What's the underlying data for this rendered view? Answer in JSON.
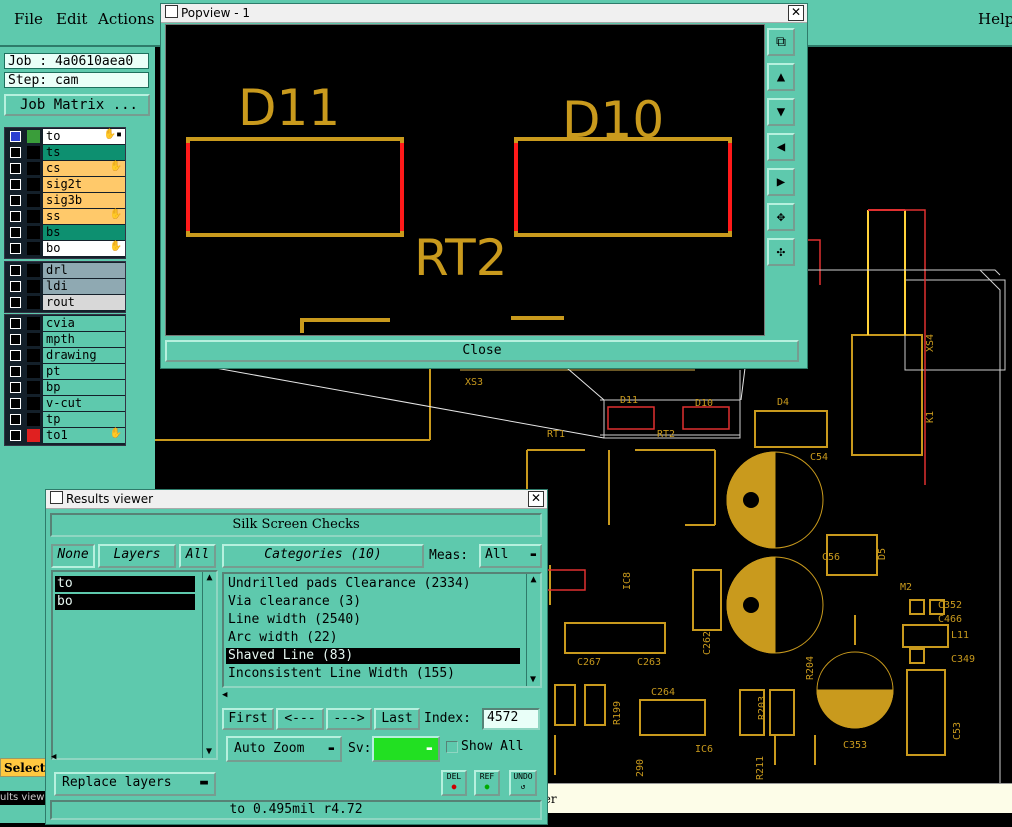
{
  "menubar": {
    "file": "File",
    "edit": "Edit",
    "actions": "Actions",
    "help": "Help"
  },
  "left": {
    "job": "Job : 4a0610aea0",
    "step": "Step: cam",
    "job_matrix": "Job Matrix ...",
    "layers_group1": [
      {
        "name": "to",
        "swatch": "#3a9d3a",
        "bg": "#ffffff",
        "mark": "✋▪",
        "selected": true
      },
      {
        "name": "ts",
        "swatch": "#000000",
        "bg": "#0d9070",
        "mark": ""
      },
      {
        "name": "cs",
        "swatch": "#000000",
        "bg": "#ffc96a",
        "mark": "✋"
      },
      {
        "name": "sig2t",
        "swatch": "#000000",
        "bg": "#ffc96a",
        "mark": ""
      },
      {
        "name": "sig3b",
        "swatch": "#000000",
        "bg": "#ffc96a",
        "mark": ""
      },
      {
        "name": "ss",
        "swatch": "#000000",
        "bg": "#ffc96a",
        "mark": "✋"
      },
      {
        "name": "bs",
        "swatch": "#000000",
        "bg": "#0d9070",
        "mark": ""
      },
      {
        "name": "bo",
        "swatch": "#000000",
        "bg": "#ffffff",
        "mark": "✋"
      }
    ],
    "layers_group2": [
      {
        "name": "drl",
        "swatch": "#000000",
        "bg": "#8fa9b2",
        "mark": ""
      },
      {
        "name": "ldi",
        "swatch": "#000000",
        "bg": "#8fa9b2",
        "mark": ""
      },
      {
        "name": "rout",
        "swatch": "#000000",
        "bg": "#d8d8d8",
        "mark": ""
      }
    ],
    "layers_group3": [
      {
        "name": "cvia",
        "swatch": "#000000",
        "bg": "#5ec9ad",
        "mark": ""
      },
      {
        "name": "mpth",
        "swatch": "#000000",
        "bg": "#5ec9ad",
        "mark": ""
      },
      {
        "name": "drawing",
        "swatch": "#000000",
        "bg": "#5ec9ad",
        "mark": ""
      },
      {
        "name": "pt",
        "swatch": "#000000",
        "bg": "#5ec9ad",
        "mark": ""
      },
      {
        "name": "bp",
        "swatch": "#000000",
        "bg": "#5ec9ad",
        "mark": ""
      },
      {
        "name": "v-cut",
        "swatch": "#000000",
        "bg": "#5ec9ad",
        "mark": ""
      },
      {
        "name": "tp",
        "swatch": "#000000",
        "bg": "#5ec9ad",
        "mark": ""
      },
      {
        "name": "to1",
        "swatch": "#e02020",
        "bg": "#5ec9ad",
        "mark": "✋"
      }
    ],
    "select": "Select",
    "results_tab": "ults view"
  },
  "board": {
    "labels": [
      "XS3",
      "D11",
      "RT2",
      "D10",
      "D4",
      "RT1",
      "C54",
      "XS4",
      "K1",
      "C56",
      "D5",
      "M2",
      "C352",
      "C466",
      "L11",
      "C349",
      "C8",
      "C262",
      "C267",
      "C263",
      "R204",
      "C264",
      "R199",
      "R203",
      "C53",
      "C353",
      "IC6",
      "290",
      "R211"
    ]
  },
  "status_text": "ner",
  "popview": {
    "title": "Popview - 1",
    "close": "✕",
    "close_button": "Close",
    "labels": {
      "d11": "D11",
      "d10": "D10",
      "rt2": "RT2"
    }
  },
  "results": {
    "title": "Results viewer",
    "close": "✕",
    "header": "Silk Screen Checks",
    "none": "None",
    "layers": "Layers",
    "all": "All",
    "layer_items": [
      "to",
      "bo"
    ],
    "categories": "Categories (10)",
    "meas_label": "Meas:",
    "meas_value": "All",
    "category_items": [
      "Undrilled pads Clearance (2334)",
      "Via clearance (3)",
      "Line width (2540)",
      "Arc width (22)",
      "Shaved Line (83)",
      "Inconsistent Line Width (155)"
    ],
    "selected_category": 4,
    "first": "First",
    "prev": "<---",
    "next": "--->",
    "last": "Last",
    "index_label": "Index:",
    "index_value": "4572",
    "auto_zoom": "Auto Zoom",
    "sv_label": "Sv:",
    "sv_color": "#22e022",
    "show_all": "Show All",
    "replace_layers": "Replace layers",
    "del": "DEL",
    "ref": "REF",
    "undo": "UNDO",
    "status": "to 0.495mil  r4.72"
  }
}
